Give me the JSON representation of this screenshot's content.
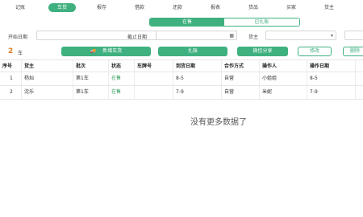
{
  "nav": {
    "items": [
      {
        "label": "记账"
      },
      {
        "label": "车货",
        "active": true
      },
      {
        "label": "报存"
      },
      {
        "label": "借款"
      },
      {
        "label": "还款"
      },
      {
        "label": "报表"
      },
      {
        "label": "货品"
      },
      {
        "label": "买家"
      },
      {
        "label": "货主"
      }
    ]
  },
  "status_tabs": {
    "active": "在售",
    "inactive": "已扎账"
  },
  "filters": {
    "start_label": "开始日期",
    "end_label": "截止日期",
    "owner_label": "货主",
    "calendar_icon": "calendar-icon",
    "dropdown_icon": "chevron-down-icon"
  },
  "summary": {
    "count": "2",
    "unit": "车"
  },
  "actions": {
    "new_label": "新增车货",
    "new_icon": "truck-icon",
    "settle_label": "扎账",
    "share_label": "微信分享",
    "edit_label": "修改",
    "delete_label": "删除"
  },
  "table": {
    "columns": [
      "序号",
      "货主",
      "批次",
      "状态",
      "车牌号",
      "到货日期",
      "合作方式",
      "操作人",
      "操作日期"
    ],
    "rows": [
      [
        "1",
        "杨灿",
        "第1车",
        "在售",
        "",
        "8-5",
        "自营",
        "小姐姐",
        "8-5"
      ],
      [
        "2",
        "沈乐",
        "第1车",
        "在售",
        "",
        "7-9",
        "自营",
        "米妮",
        "7-9"
      ]
    ]
  },
  "empty_text": "没有更多数据了",
  "colors": {
    "accent": "#3fb07f",
    "count": "#e07a1f",
    "status_text": "#2e9e5b"
  }
}
